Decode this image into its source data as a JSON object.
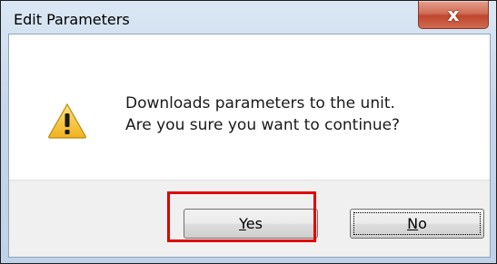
{
  "window": {
    "title": "Edit Parameters",
    "close_glyph": "x"
  },
  "icon": "warning-icon",
  "message": {
    "line1": "Downloads parameters to the unit.",
    "line2": "Are you sure you want to continue?"
  },
  "buttons": {
    "yes": {
      "mnemonic": "Y",
      "rest": "es"
    },
    "no": {
      "mnemonic": "N",
      "rest": "o"
    }
  },
  "colors": {
    "highlight": "#e00000",
    "warning_fill": "#f6c431",
    "close_button": "#c0462d"
  }
}
